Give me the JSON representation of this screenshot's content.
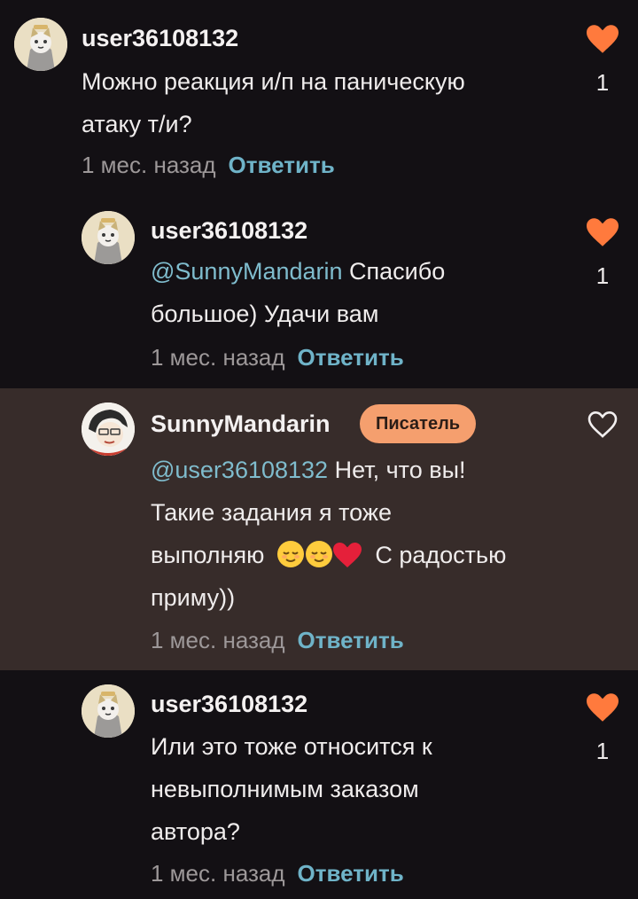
{
  "comments": [
    {
      "username": "user36108132",
      "mention": "",
      "lines": [
        "Можно реакция и/п на паническую",
        "атаку т/и?"
      ],
      "time": "1 мес. назад",
      "reply_label": "Ответить",
      "liked": true,
      "likes": "1"
    },
    {
      "username": "user36108132",
      "mention": "@SunnyMandarin",
      "lines": [
        "Спасибо",
        "большое) Удачи вам"
      ],
      "time": "1 мес. назад",
      "reply_label": "Ответить",
      "liked": true,
      "likes": "1"
    },
    {
      "username": "SunnyMandarin",
      "badge": "Писатель",
      "mention": "@user36108132",
      "lines": [
        "Нет, что вы!",
        "Такие задания я тоже",
        "выполняю",
        "С радостью",
        "приму))"
      ],
      "emojis": [
        "relieved-face",
        "relieved-face",
        "red-heart"
      ],
      "time": "1 мес. назад",
      "reply_label": "Ответить",
      "liked": false
    },
    {
      "username": "user36108132",
      "mention": "",
      "lines": [
        "Или это тоже относится к",
        "невыполнимым заказом",
        "автора?"
      ],
      "time": "1 мес. назад",
      "reply_label": "Ответить",
      "liked": true,
      "likes": "1"
    }
  ],
  "colors": {
    "background": "#131014",
    "highlight": "#372c2a",
    "heart": "#ff7a3d",
    "mention": "#7fbccd",
    "reply": "#6fb3c8",
    "badge": "#f59f6e"
  },
  "icons": [
    "avatar-cat",
    "avatar-mandarin",
    "heart-filled-icon",
    "heart-outline-icon"
  ]
}
